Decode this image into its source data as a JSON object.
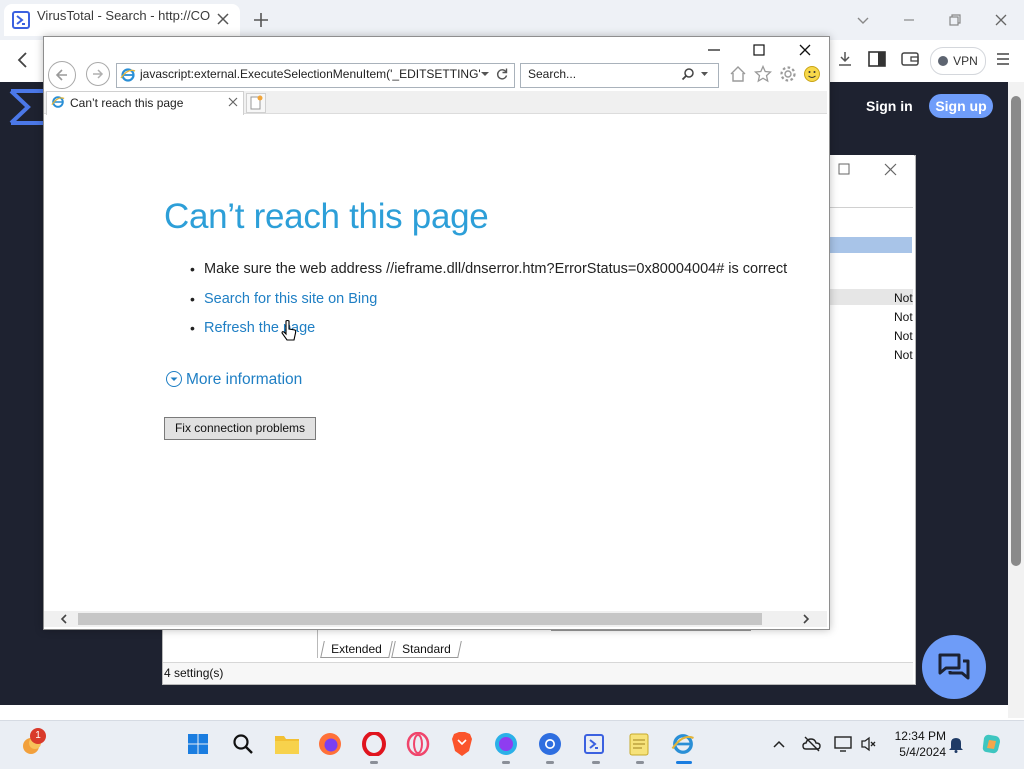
{
  "outer_browser": {
    "tab_title": "VirusTotal - Search - http://COL",
    "vpn_label": "VPN"
  },
  "virustotal": {
    "sign_in": "Sign in",
    "sign_up": "Sign up"
  },
  "settings_dialog": {
    "rows": [
      "Not",
      "Not",
      "Not",
      "Not"
    ],
    "tabs": [
      "Extended",
      "Standard"
    ],
    "status": "4 setting(s)"
  },
  "ie": {
    "address": "javascript:external.ExecuteSelectionMenuItem('_EDITSETTING')",
    "search_placeholder": "Search...",
    "tab_title": "Can’t reach this page",
    "error_title": "Can’t reach this page",
    "bullets": [
      "Make sure the web address //ieframe.dll/dnserror.htm?ErrorStatus=0x80004004# is correct",
      "Search for this site on Bing",
      "Refresh the page"
    ],
    "more_info": "More information",
    "fix_button": "Fix connection problems"
  },
  "taskbar": {
    "badge_count": "1",
    "time": "12:34 PM",
    "date": "5/4/2024"
  },
  "colors": {
    "ie_heading": "#2d9fd8",
    "ie_link": "#1f7fc4",
    "vt_dark": "#1e2230",
    "vt_accent": "#6f9dfa"
  }
}
